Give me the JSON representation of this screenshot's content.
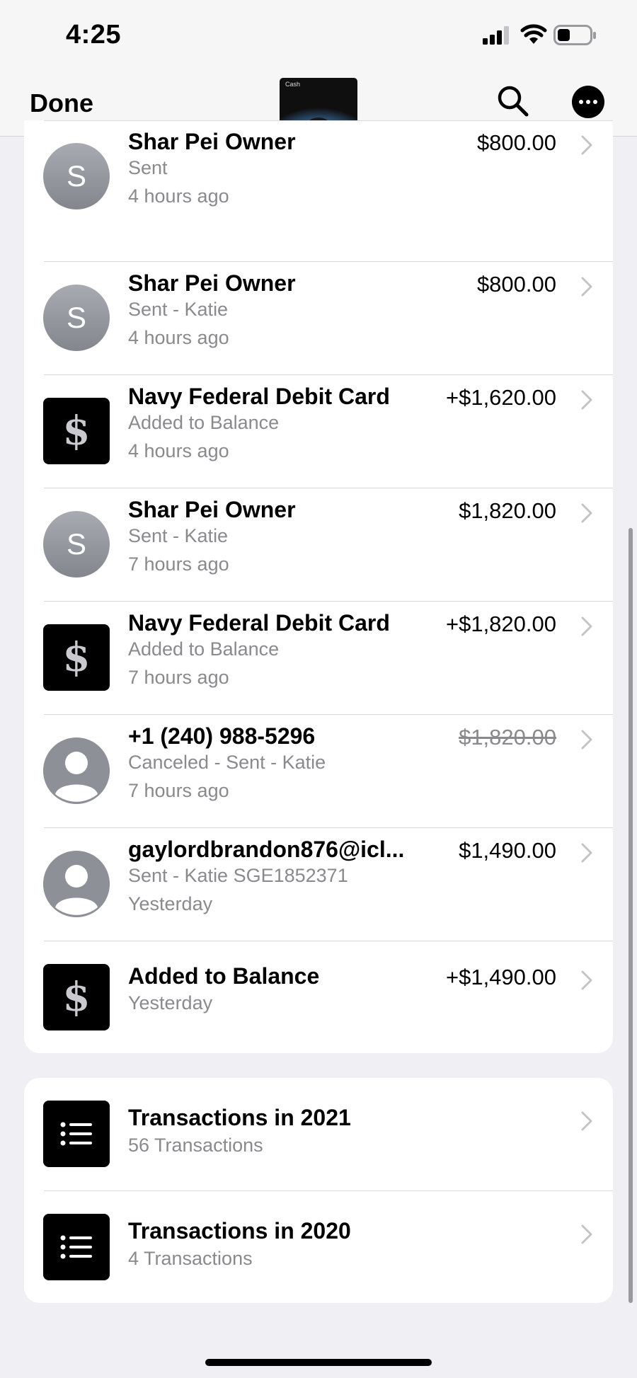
{
  "status_bar": {
    "time": "4:25"
  },
  "nav": {
    "done_label": "Done",
    "card_brand": "Cash"
  },
  "transactions": [
    {
      "name": "Shar Pei Owner",
      "detail": "Sent",
      "time": "4 hours ago",
      "amount": "$800.00",
      "avatar_letter": "S"
    },
    {
      "name": "Shar Pei Owner",
      "detail": "Sent - Katie",
      "time": "4 hours ago",
      "amount": "$800.00",
      "avatar_letter": "S"
    },
    {
      "name": "Navy Federal Debit Card",
      "detail": "Added to Balance",
      "time": "4 hours ago",
      "amount": "+$1,620.00",
      "avatar_glyph": "$"
    },
    {
      "name": "Shar Pei Owner",
      "detail": "Sent - Katie",
      "time": "7 hours ago",
      "amount": "$1,820.00",
      "avatar_letter": "S"
    },
    {
      "name": "Navy Federal Debit Card",
      "detail": "Added to Balance",
      "time": "7 hours ago",
      "amount": "+$1,820.00",
      "avatar_glyph": "$"
    },
    {
      "name": "+1 (240) 988-5296",
      "detail": "Canceled - Sent - Katie",
      "time": "7 hours ago",
      "amount": "$1,820.00"
    },
    {
      "name": "gaylordbrandon876@icl...",
      "detail": "Sent - Katie SGE1852371",
      "time": "Yesterday",
      "amount": "$1,490.00"
    },
    {
      "name": "Added to Balance",
      "time": "Yesterday",
      "amount": "+$1,490.00",
      "avatar_glyph": "$"
    }
  ],
  "years": [
    {
      "title": "Transactions in 2021",
      "count": "56 Transactions"
    },
    {
      "title": "Transactions in 2020",
      "count": "4 Transactions"
    }
  ]
}
